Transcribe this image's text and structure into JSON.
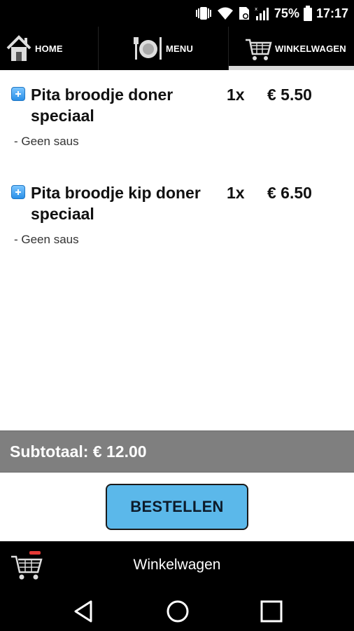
{
  "status_bar": {
    "battery_percent": "75%",
    "time": "17:17"
  },
  "top_nav": {
    "tabs": [
      {
        "label": "HOME",
        "icon": "house-icon"
      },
      {
        "label": "MENU",
        "icon": "plate-cutlery-icon"
      },
      {
        "label": "WINKELWAGEN",
        "icon": "shopping-cart-icon",
        "active": true
      }
    ]
  },
  "cart": {
    "items": [
      {
        "name": "Pita broodje doner speciaal",
        "quantity": "1x",
        "price": "€ 5.50",
        "option": "- Geen saus"
      },
      {
        "name": "Pita broodje kip doner speciaal",
        "quantity": "1x",
        "price": "€ 6.50",
        "option": "- Geen saus"
      }
    ],
    "subtotal": "Subtotaal: € 12.00"
  },
  "order_button_label": "BESTELLEN",
  "bottom_bar": {
    "title": "Winkelwagen"
  },
  "colors": {
    "accent_button": "#5bb8ea",
    "subtotal_bar": "#7f7f7f",
    "bars": "#000000"
  }
}
